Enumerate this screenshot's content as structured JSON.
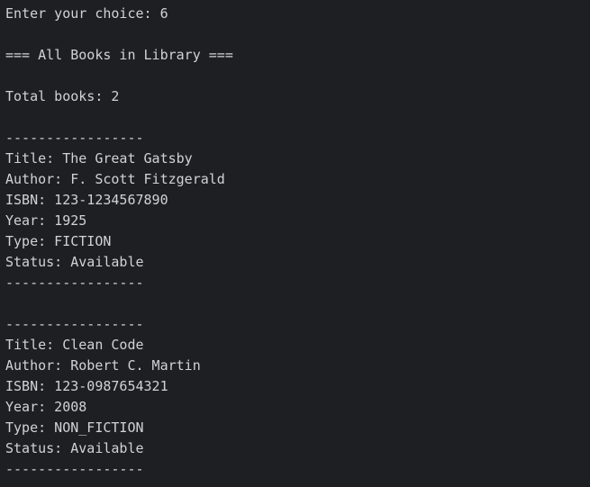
{
  "terminal": {
    "lines": [
      "Enter your choice: 6",
      "",
      "=== All Books in Library ===",
      "",
      "Total books: 2",
      "",
      "-----------------",
      "Title: The Great Gatsby",
      "Author: F. Scott Fitzgerald",
      "ISBN: 123-1234567890",
      "Year: 1925",
      "Type: FICTION",
      "Status: Available",
      "-----------------",
      "",
      "-----------------",
      "Title: Clean Code",
      "Author: Robert C. Martin",
      "ISBN: 123-0987654321",
      "Year: 2008",
      "Type: NON_FICTION",
      "Status: Available",
      "-----------------"
    ]
  }
}
